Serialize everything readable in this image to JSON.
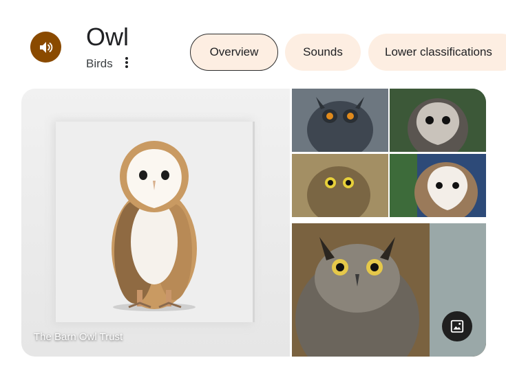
{
  "header": {
    "title": "Owl",
    "subtitle": "Birds",
    "sound_icon": "speaker-icon",
    "more_icon": "more-vert-icon"
  },
  "chips": [
    {
      "label": "Overview",
      "selected": true
    },
    {
      "label": "Sounds",
      "selected": false
    },
    {
      "label": "Lower classifications",
      "selected": false
    }
  ],
  "gallery": {
    "main_caption": "The Barn Owl Trust",
    "tile_subjects": [
      "eagle owl",
      "sooty owl",
      "little owl",
      "barn owl",
      "great horned owl"
    ],
    "image_button_icon": "image-icon"
  },
  "colors": {
    "accent": "#8a4a00",
    "chip_bg": "#fdeee2",
    "chip_selected_border": "#2b2b2b"
  }
}
